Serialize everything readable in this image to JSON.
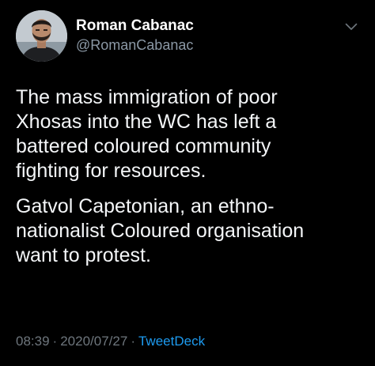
{
  "author": {
    "display_name": "Roman Cabanac",
    "handle": "@RomanCabanac",
    "avatar_icon": "profile-photo"
  },
  "tweet": {
    "paragraphs": [
      "The mass immigration of poor\nXhosas into the WC has left a\nbattered coloured community\nfighting for resources.",
      "Gatvol Capetonian, an ethno-\nnationalist Coloured organisation\nwant to protest."
    ]
  },
  "meta": {
    "time": "08:39",
    "date": "2020/07/27",
    "separator": "·",
    "source": "TweetDeck"
  },
  "menu_icon": "chevron-down-icon",
  "colors": {
    "background": "#000000",
    "text": "#ffffff",
    "muted": "#6e767d",
    "link": "#1d9bf0"
  }
}
